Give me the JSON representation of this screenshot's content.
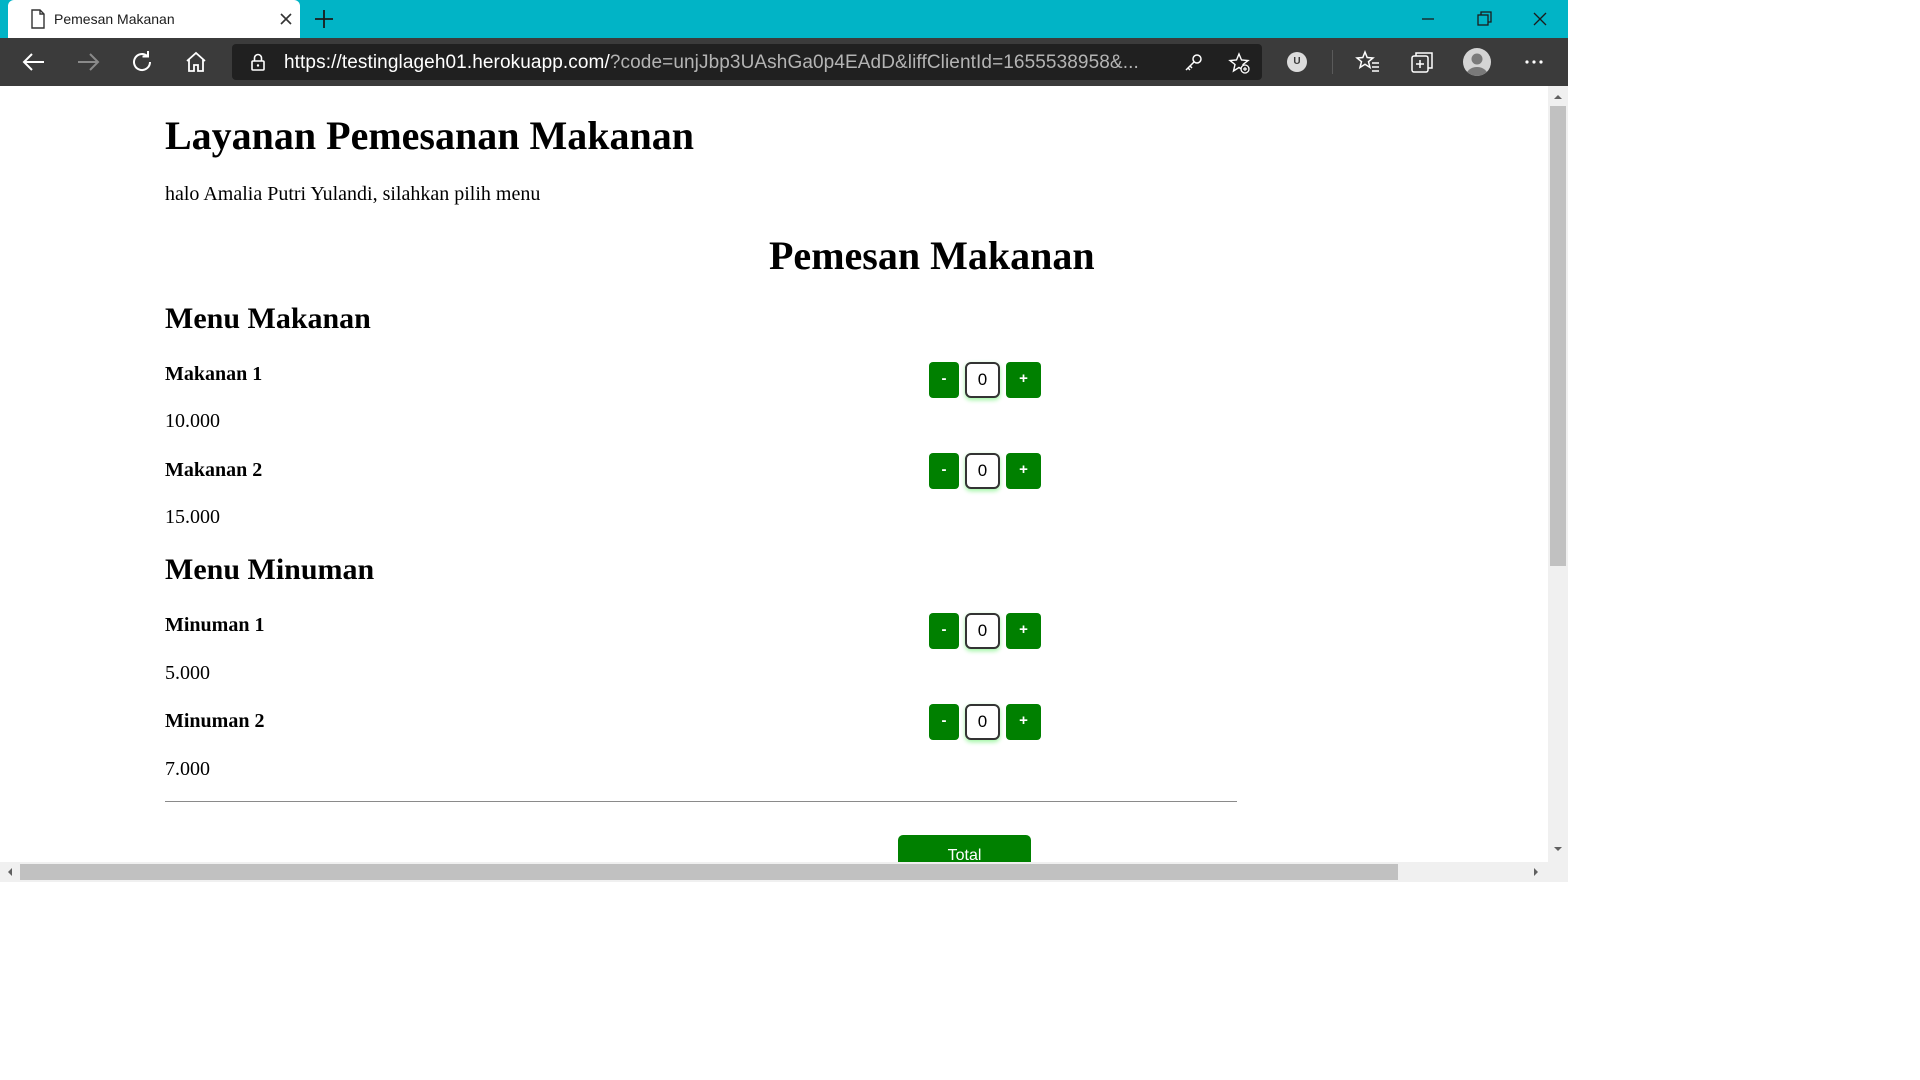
{
  "browser": {
    "tab_title": "Pemesan Makanan",
    "url_host": "https://testinglageh01.herokuapp.com/",
    "url_rest": "?code=unjJbp3UAshGa0p4EAdD&liffClientId=1655538958&...",
    "profile_badge": "U",
    "colors": {
      "tabstrip": "#01b4c6",
      "toolbar": "#3b3b3b",
      "addressbar": "#202020"
    }
  },
  "page": {
    "title": "Layanan Pemesanan Makanan",
    "greeting": "halo Amalia Putri Yulandi, silahkan pilih menu",
    "order_heading": "Pemesan Makanan",
    "sections": [
      {
        "heading": "Menu Makanan",
        "items": [
          {
            "name": "Makanan 1",
            "price": "10.000",
            "qty": "0"
          },
          {
            "name": "Makanan 2",
            "price": "15.000",
            "qty": "0"
          }
        ]
      },
      {
        "heading": "Menu Minuman",
        "items": [
          {
            "name": "Minuman 1",
            "price": "5.000",
            "qty": "0"
          },
          {
            "name": "Minuman 2",
            "price": "7.000",
            "qty": "0"
          }
        ]
      }
    ],
    "minus_label": "-",
    "plus_label": "+",
    "total_label": "Total",
    "colors": {
      "button": "#008000",
      "text": "#000000"
    }
  }
}
